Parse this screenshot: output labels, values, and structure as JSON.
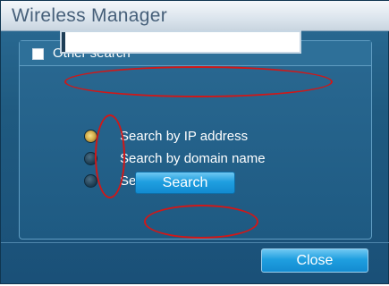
{
  "window": {
    "title": "Wireless Manager"
  },
  "search_group": {
    "checkbox_label": "Other search",
    "search_input": {
      "value": "",
      "placeholder": ""
    },
    "options": [
      {
        "label": "Search by IP address",
        "checked": true
      },
      {
        "label": "Search by domain name",
        "checked": false
      },
      {
        "label": "Search by ID",
        "checked": false
      }
    ],
    "search_button": "Search"
  },
  "footer": {
    "close_button": "Close"
  },
  "colors": {
    "window_bg": "#1f5a80",
    "titlebar": "#dde6ee",
    "title_text": "#47607a",
    "button": "#1f9fe0",
    "highlight": "#d01818"
  }
}
